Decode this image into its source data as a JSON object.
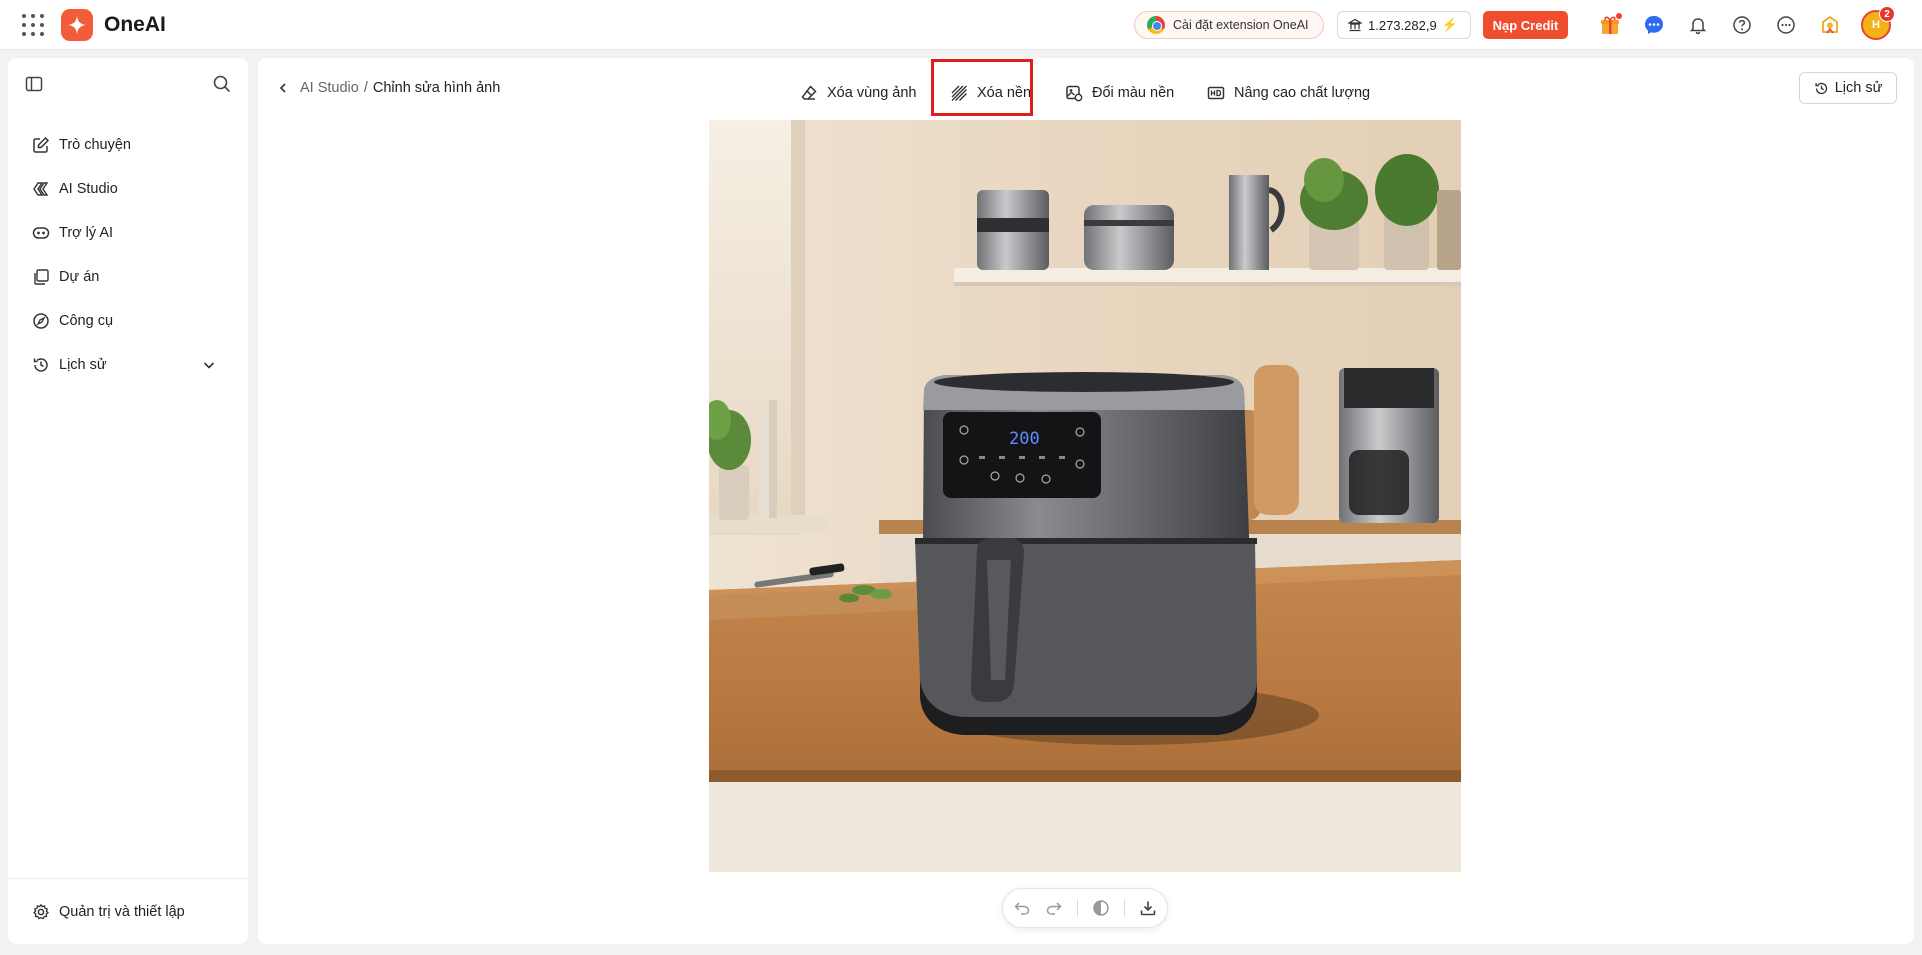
{
  "app": {
    "name": "OneAI"
  },
  "header": {
    "extension_label": "Cài đặt extension OneAI",
    "credit_balance": "1.273.282,9",
    "topup_label": "Nạp Credit",
    "avatar_initials": "H",
    "notification_count": "2"
  },
  "sidebar": {
    "items": [
      {
        "label": "Trò chuyện",
        "icon": "edit-icon"
      },
      {
        "label": "AI Studio",
        "icon": "studio-icon"
      },
      {
        "label": "Trợ lý AI",
        "icon": "bot-icon"
      },
      {
        "label": "Dự án",
        "icon": "folder-icon"
      },
      {
        "label": "Công cụ",
        "icon": "compass-icon"
      },
      {
        "label": "Lịch sử",
        "icon": "history-icon"
      }
    ],
    "footer_label": "Quản trị và thiết lập"
  },
  "main": {
    "breadcrumb": {
      "parent": "AI Studio",
      "separator": "/",
      "current": "Chỉnh sửa hình ảnh"
    },
    "tools": [
      {
        "label": "Xóa vùng ảnh",
        "icon": "eraser-icon"
      },
      {
        "label": "Xóa nền",
        "icon": "remove-background-icon",
        "highlighted": true
      },
      {
        "label": "Đổi màu nền",
        "icon": "recolor-background-icon"
      },
      {
        "label": "Nâng cao chất lượng",
        "icon": "hd-icon"
      }
    ],
    "history_label": "Lịch sử",
    "image_display": {
      "lcd_text": "200"
    }
  },
  "colors": {
    "brand": "#f25c38",
    "topup": "#f04d2f",
    "highlight": "#e01e1e"
  }
}
